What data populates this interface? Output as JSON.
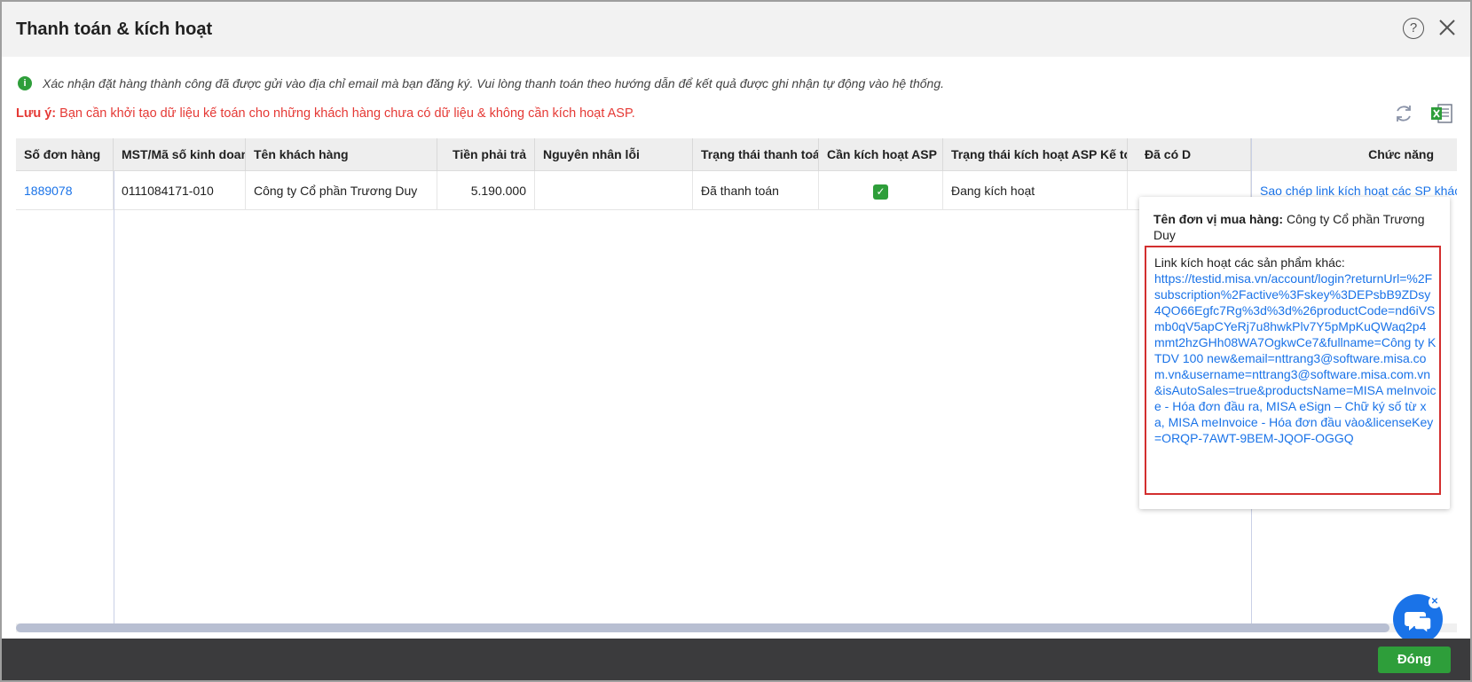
{
  "dialog": {
    "title": "Thanh toán & kích hoạt",
    "help_glyph": "?",
    "info_glyph": "i",
    "info_message": "Xác nhận đặt hàng thành công đã được gửi vào địa chỉ email mà bạn đăng ký. Vui lòng thanh toán theo hướng dẫn để kết quả được ghi nhận tự động vào hệ thống.",
    "note_label": "Lưu ý:",
    "note_text": " Bạn cần khởi tạo dữ liệu kế toán cho những khách hàng chưa có dữ liệu & không cần kích hoạt ASP."
  },
  "table": {
    "columns": [
      "Số đơn hàng",
      "MST/Mã số kinh doanh",
      "Tên khách hàng",
      "Tiền phải trả",
      "Nguyên nhân lỗi",
      "Trạng thái thanh toán",
      "Cần kích hoạt ASP",
      "Trạng thái kích hoạt ASP Kế toán",
      "Đã có D",
      "Chức năng"
    ],
    "rows": [
      {
        "order_no": "1889078",
        "tax_code": "0111084171-010",
        "customer": "Công ty Cổ phần Trương Duy",
        "amount": "5.190.000",
        "error_reason": "",
        "payment_status": "Đã thanh toán",
        "need_asp_checked": "✓",
        "asp_status": "Đang kích hoạt",
        "has_data": "",
        "action": "Sao chép link kích hoạt các SP khác"
      }
    ]
  },
  "tooltip": {
    "buyer_label": "Tên đơn vị mua hàng:",
    "buyer_value": " Công ty Cổ phần Trương Duy",
    "link_label": "Link kích hoạt các sản phẩm khác:",
    "link_url": "https://testid.misa.vn/account/login?returnUrl=%2Fsubscription%2Factive%3Fskey%3DEPsbB9ZDsy4QO66Egfc7Rg%3d%3d%26productCode=nd6iVSmb0qV5apCYeRj7u8hwkPlv7Y5pMpKuQWaq2p4mmt2hzGHh08WA7OgkwCe7&fullname=Công ty KTDV 100 new&email=nttrang3@software.misa.com.vn&username=nttrang3@software.misa.com.vn&isAutoSales=true&productsName=MISA meInvoice - Hóa đơn đầu ra, MISA eSign – Chữ ký số từ xa, MISA meInvoice - Hóa đơn đầu vào&licenseKey=ORQP-7AWT-9BEM-JQOF-OGGQ"
  },
  "footer": {
    "close_label": "Đóng"
  },
  "chat": {
    "dismiss_glyph": "✕"
  }
}
